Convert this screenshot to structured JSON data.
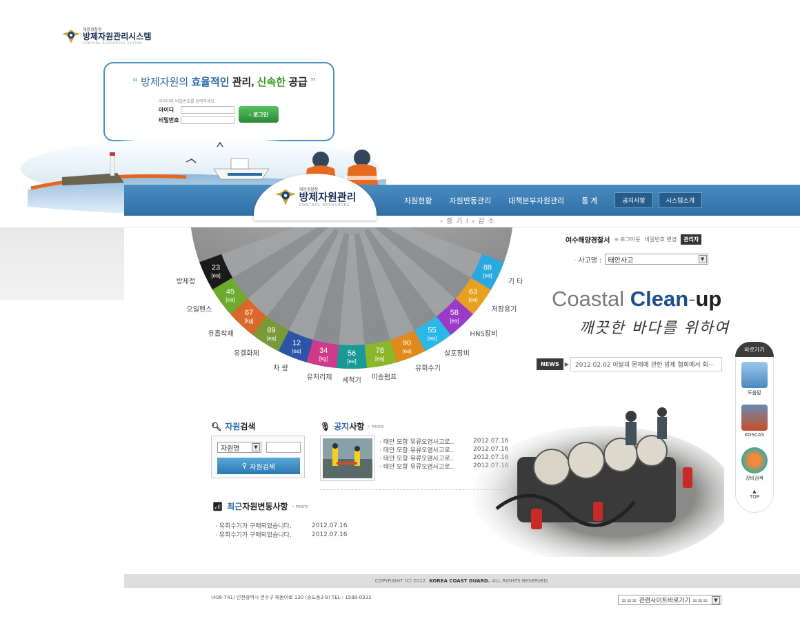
{
  "login": {
    "logo_small": "해양경찰청",
    "logo_title": "방제자원관리시스템",
    "logo_english": "CONTROL RESOURCES SYSTEM",
    "slogan_pre": "방제자원의 ",
    "slogan_efficient": "효율적인",
    "slogan_mid": " 관리, ",
    "slogan_fast": "신속한",
    "slogan_supply": " 공급",
    "hint": "아이디와 비밀번호를 입력하세요.",
    "id_label": "아이디",
    "pw_label": "비밀번호",
    "login_button": "› 로그인"
  },
  "header": {
    "logo_small": "해양경찰청",
    "logo_title": "방제자원관리",
    "logo_english": "CONTROL RESOURCES",
    "menu": [
      "자원현황",
      "자원변동관리",
      "대책본부자원관리",
      "통 계"
    ],
    "pills": [
      "공지사항",
      "시스템소개"
    ],
    "subnav": "› 증 가   I   › 감 소"
  },
  "user": {
    "org": "여수해양경찰서",
    "logout": "로그아웃",
    "change_pw": "비밀번호 변경",
    "role": "관리자",
    "incident_label": "· 사고명 :",
    "incident_value": "태안사고"
  },
  "hero": {
    "coastal": "Coastal ",
    "clean": "Clean",
    "dash": "-",
    "up": "up",
    "tagline": "깨끗한 바다를 위하여"
  },
  "news": {
    "tag": "NEWS",
    "text": "2012.02.02 이달의 문제에 관한 방제 협회에서 회···"
  },
  "wheel": {
    "segments": [
      {
        "label": "방제정",
        "value": "23",
        "unit": "[ea]",
        "color": "#1a1a1a"
      },
      {
        "label": "오일펜스",
        "value": "45",
        "unit": "[ea]",
        "color": "#6cab2e"
      },
      {
        "label": "유흡착재",
        "value": "67",
        "unit": "[kg]",
        "color": "#d9682a"
      },
      {
        "label": "유겔화제",
        "value": "89",
        "unit": "[ea]",
        "color": "#7a9a3a"
      },
      {
        "label": "차 량",
        "value": "12",
        "unit": "[ea]",
        "color": "#2c55a8"
      },
      {
        "label": "유처리제",
        "value": "34",
        "unit": "[kg]",
        "color": "#d03a8a"
      },
      {
        "label": "세척기",
        "value": "56",
        "unit": "[ea]",
        "color": "#1a9a96"
      },
      {
        "label": "이송펌프",
        "value": "78",
        "unit": "[ea]",
        "color": "#8ab82a"
      },
      {
        "label": "유회수기",
        "value": "90",
        "unit": "[ea]",
        "color": "#e08a1a"
      },
      {
        "label": "살포장비",
        "value": "55",
        "unit": "[ea]",
        "color": "#2ab8e8"
      },
      {
        "label": "HNS장비",
        "value": "58",
        "unit": "[ea]",
        "color": "#9a3ac8"
      },
      {
        "label": "저장용기",
        "value": "63",
        "unit": "[ea]",
        "color": "#e8a020"
      },
      {
        "label": "기 타",
        "value": "88",
        "unit": "[ea]",
        "color": "#2aa8e0"
      }
    ]
  },
  "quick": {
    "title": "바로가기",
    "items": [
      "도움말",
      "KOSCAS",
      "장비검색"
    ],
    "top": "TOP"
  },
  "search": {
    "title_hl": "자원",
    "title_rest": "검색",
    "select_value": "자원명",
    "button": "자원검색"
  },
  "notice": {
    "title_hl": "공지",
    "title_rest": "사항",
    "more": "› more",
    "items": [
      {
        "title": "· 태안 모항 유류오염사고로..",
        "date": "2012.07.16"
      },
      {
        "title": "· 태안 모항 유류오염사고로..",
        "date": "2012.07.16"
      },
      {
        "title": "· 태안 모항 유류오염사고로..",
        "date": "2012.07.16"
      },
      {
        "title": "· 태안 모항 유류오염사고로..",
        "date": "2012.07.16"
      }
    ]
  },
  "recent": {
    "title_hl": "최근",
    "title_rest": "자원변동사항",
    "more": "› more",
    "items": [
      {
        "title": "· 유회수기가 구매되었습니다.",
        "date": "2012.07.16"
      },
      {
        "title": "· 유회수기가 구매되었습니다.",
        "date": "2012.07.16"
      }
    ]
  },
  "footer": {
    "copyright_pre": "COPYRIGHT (C) 2012.",
    "copyright_org": "KOREA COAST GUARD.",
    "copyright_post": "ALL RIGHTS RESERVED.",
    "address": "(406-741) 인천광역시 연수구 해돋이로 130 (송도동3-8) TEL : 1588-0333",
    "related": "=== 관련사이트바로가기 ==="
  }
}
